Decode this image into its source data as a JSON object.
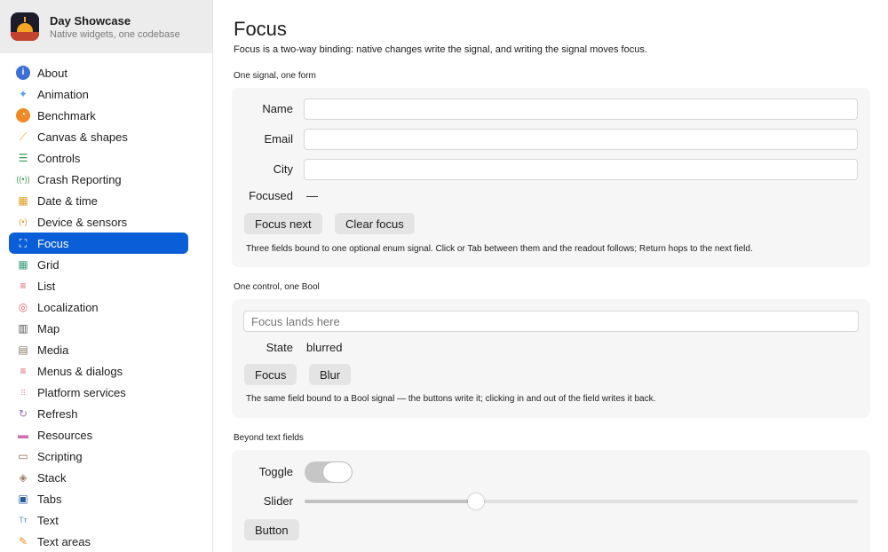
{
  "app": {
    "title": "Day Showcase",
    "subtitle": "Native widgets, one codebase"
  },
  "sidebar": {
    "items": [
      {
        "label": "About",
        "icon": "info-icon",
        "color": "#3d6ed6"
      },
      {
        "label": "Animation",
        "icon": "sparkles-icon",
        "color": "#5aa0e6"
      },
      {
        "label": "Benchmark",
        "icon": "gauge-icon",
        "color": "#f08a24"
      },
      {
        "label": "Canvas & shapes",
        "icon": "brush-icon",
        "color": "#f0a030"
      },
      {
        "label": "Controls",
        "icon": "sliders-icon",
        "color": "#3a9a50"
      },
      {
        "label": "Crash Reporting",
        "icon": "broadcast-icon",
        "color": "#3a9a50"
      },
      {
        "label": "Date & time",
        "icon": "calendar-icon",
        "color": "#e0a020"
      },
      {
        "label": "Device & sensors",
        "icon": "sensor-icon",
        "color": "#e0a020"
      },
      {
        "label": "Focus",
        "icon": "focus-icon",
        "color": "#ffffff",
        "active": true
      },
      {
        "label": "Grid",
        "icon": "grid-icon",
        "color": "#40a080"
      },
      {
        "label": "List",
        "icon": "list-icon",
        "color": "#e05a6a"
      },
      {
        "label": "Localization",
        "icon": "globe-icon",
        "color": "#e05a6a"
      },
      {
        "label": "Map",
        "icon": "map-icon",
        "color": "#555555"
      },
      {
        "label": "Media",
        "icon": "film-icon",
        "color": "#8a7a6a"
      },
      {
        "label": "Menus & dialogs",
        "icon": "menu-icon",
        "color": "#e05a6a"
      },
      {
        "label": "Platform services",
        "icon": "dots-grid-icon",
        "color": "#d070b0"
      },
      {
        "label": "Refresh",
        "icon": "refresh-icon",
        "color": "#a070c0"
      },
      {
        "label": "Resources",
        "icon": "folder-icon",
        "color": "#d070b0"
      },
      {
        "label": "Scripting",
        "icon": "terminal-icon",
        "color": "#8a6a50"
      },
      {
        "label": "Stack",
        "icon": "stack-icon",
        "color": "#a08070"
      },
      {
        "label": "Tabs",
        "icon": "tabs-icon",
        "color": "#2a5a9a"
      },
      {
        "label": "Text",
        "icon": "text-icon",
        "color": "#5a8ac0"
      },
      {
        "label": "Text areas",
        "icon": "doc-edit-icon",
        "color": "#f08a24"
      }
    ]
  },
  "page": {
    "title": "Focus",
    "description": "Focus is a two-way binding: native changes write the signal, and writing the signal moves focus."
  },
  "section1": {
    "label": "One signal, one form",
    "fields": [
      {
        "label": "Name",
        "value": ""
      },
      {
        "label": "Email",
        "value": ""
      },
      {
        "label": "City",
        "value": ""
      }
    ],
    "focused_label": "Focused",
    "focused_value": "—",
    "focus_next_label": "Focus next",
    "clear_focus_label": "Clear focus",
    "helper": "Three fields bound to one optional enum signal. Click or Tab between them and the readout follows; Return hops to the next field."
  },
  "section2": {
    "label": "One control, one Bool",
    "placeholder": "Focus lands here",
    "state_label": "State",
    "state_value": "blurred",
    "focus_label": "Focus",
    "blur_label": "Blur",
    "helper": "The same field bound to a Bool signal — the buttons write it; clicking in and out of the field writes it back."
  },
  "section3": {
    "label": "Beyond text fields",
    "toggle_label": "Toggle",
    "toggle_on": true,
    "slider_label": "Slider",
    "slider_value": 0.31,
    "button_label": "Button"
  },
  "colors": {
    "accent": "#0a5fd8",
    "card": "#f6f6f6",
    "button": "#e4e4e4"
  }
}
